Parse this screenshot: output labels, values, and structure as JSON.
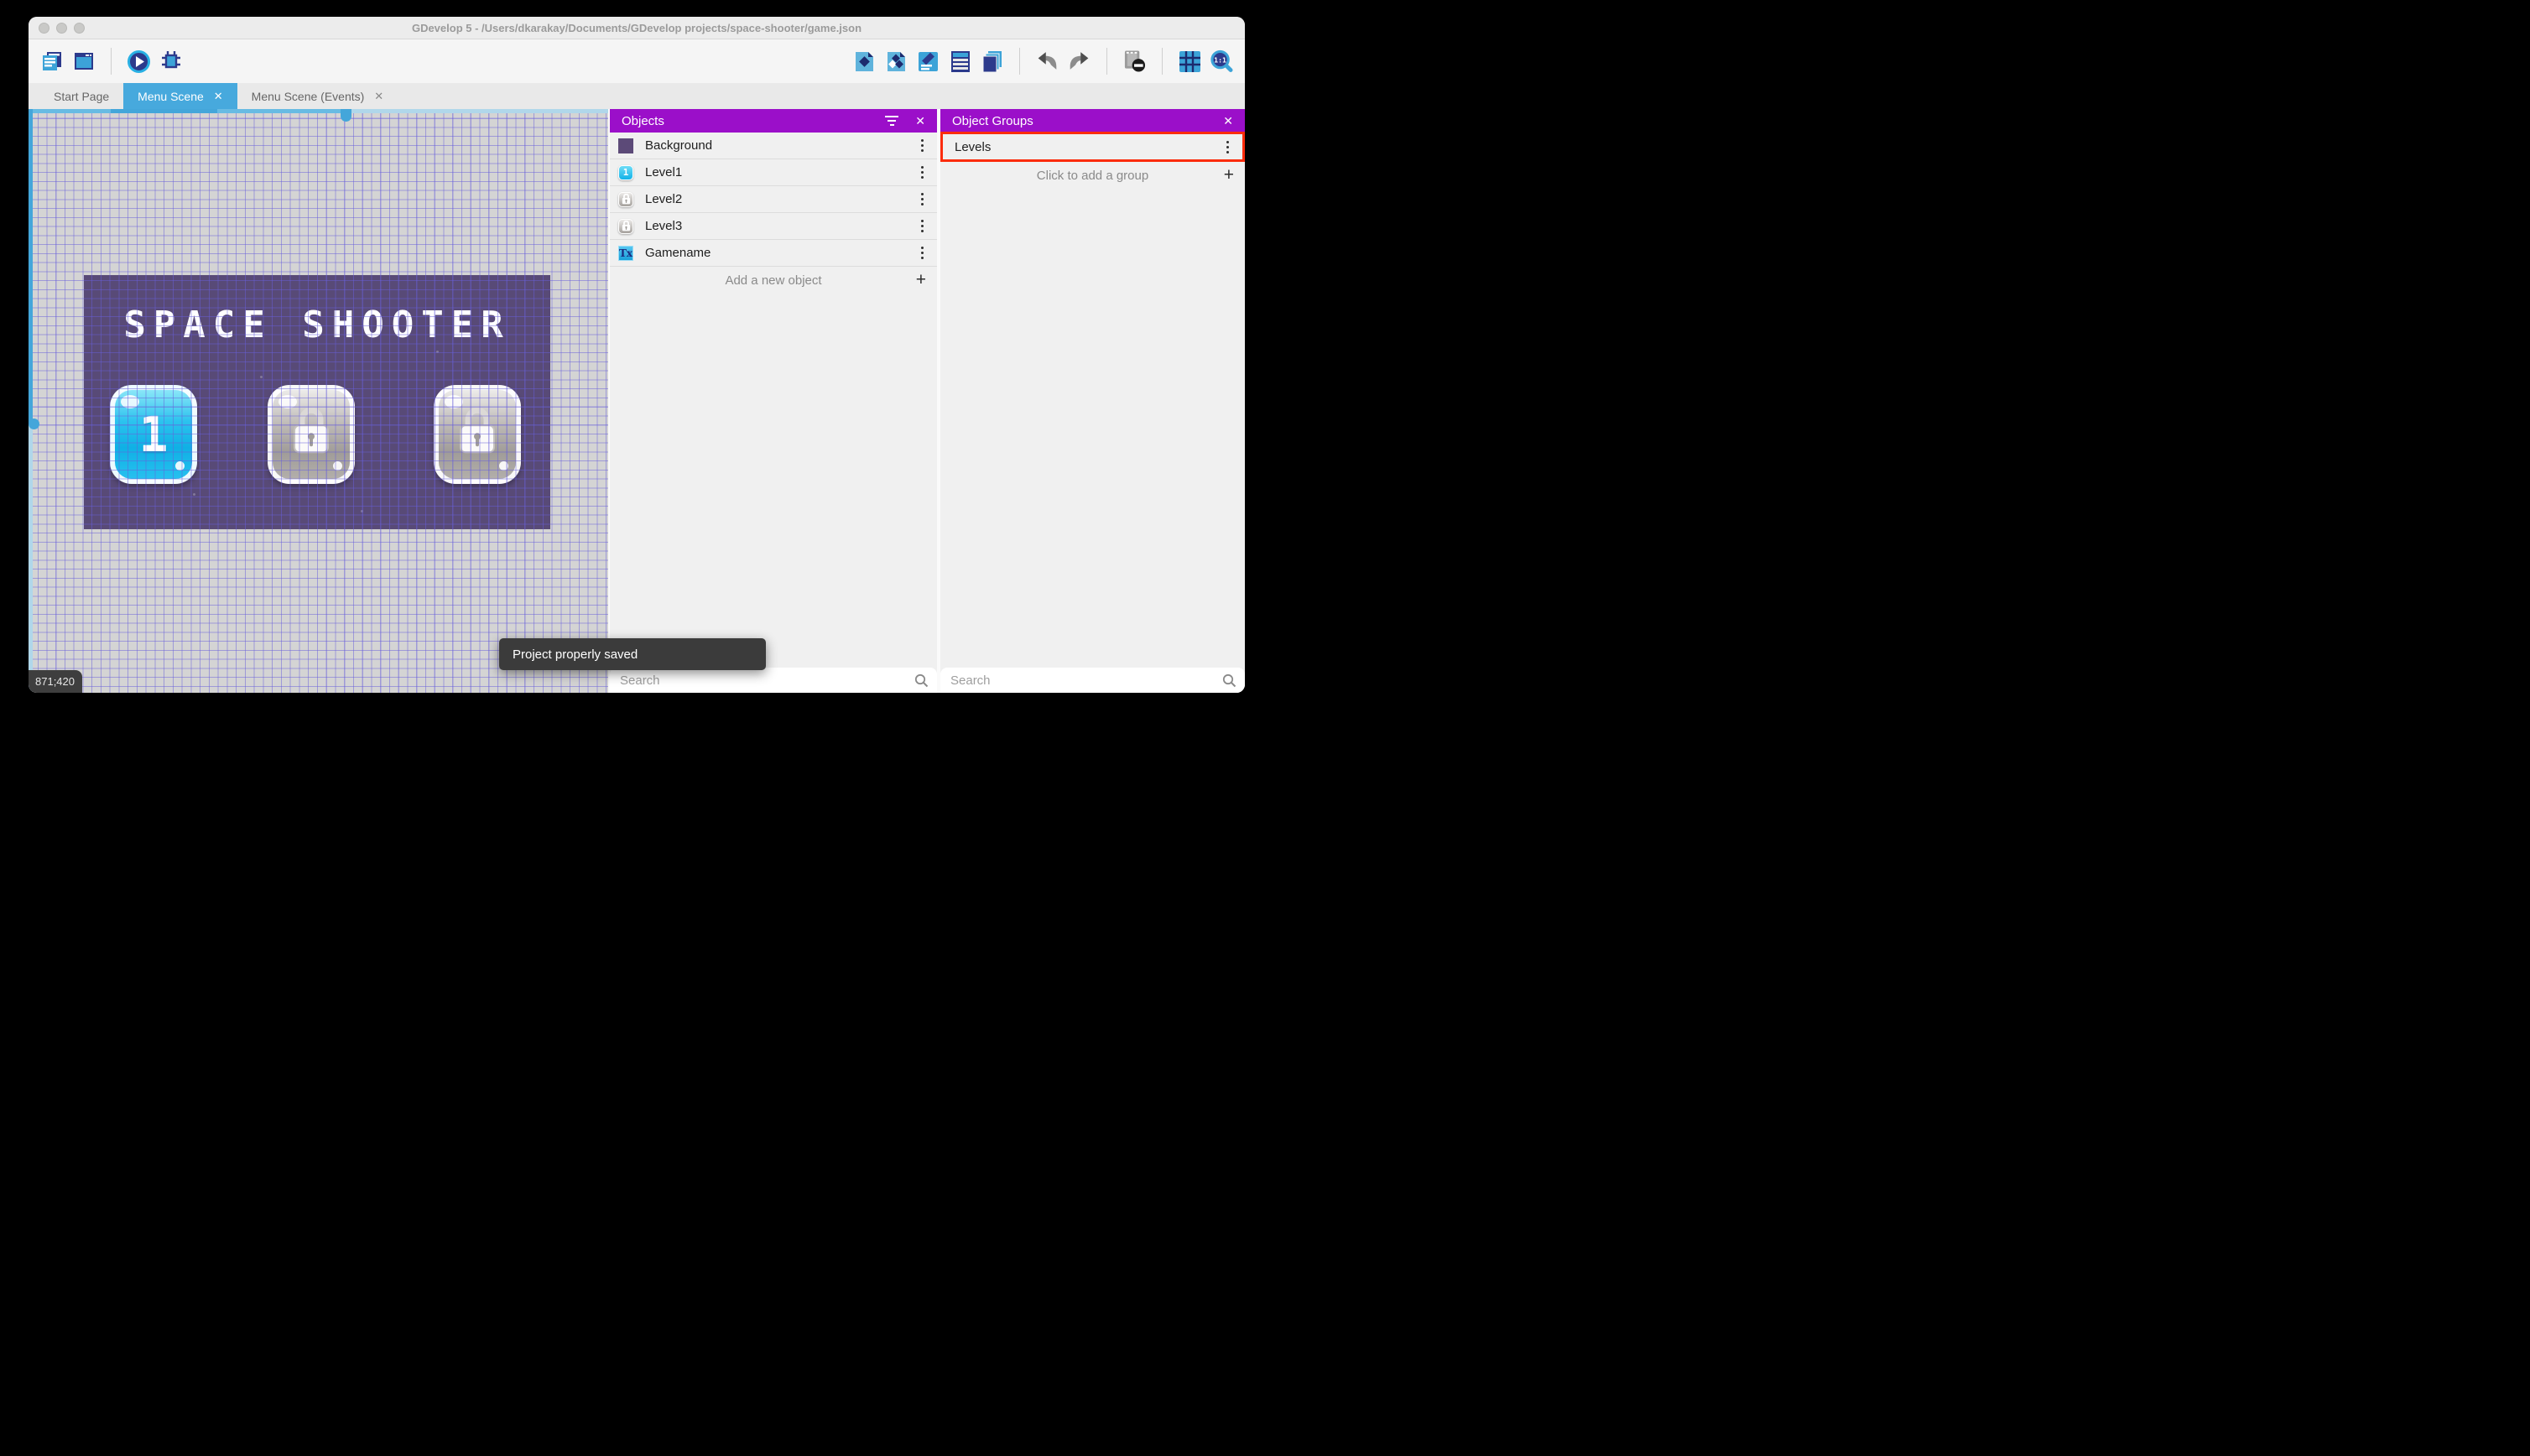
{
  "window_title": "GDevelop 5 - /Users/dkarakay/Documents/GDevelop projects/space-shooter/game.json",
  "glyphs": {
    "close": "✕",
    "plus": "+"
  },
  "toolbar": {
    "left_icons": [
      "project-manager",
      "start-page",
      "play",
      "debug"
    ],
    "right_icons": [
      "edit-objects",
      "edit-object-groups",
      "edit-scene-properties",
      "edit-instances-list",
      "edit-layers",
      "undo",
      "redo",
      "toggle-mask",
      "toggle-grid",
      "zoom-1-1"
    ],
    "zoom_label": "1:1"
  },
  "tabs": [
    {
      "label": "Start Page",
      "active": false,
      "closable": false
    },
    {
      "label": "Menu Scene",
      "active": true,
      "closable": true
    },
    {
      "label": "Menu Scene (Events)",
      "active": false,
      "closable": true
    }
  ],
  "scene": {
    "game_title": "SPACE SHOOTER",
    "level_buttons": [
      {
        "label": "1",
        "locked": false
      },
      {
        "label": "",
        "locked": true
      },
      {
        "label": "",
        "locked": true
      }
    ],
    "cursor_coordinates": "871;420"
  },
  "objects_panel": {
    "title": "Objects",
    "items": [
      {
        "name": "Background",
        "icon": "background-thumbnail",
        "thumb_label": ""
      },
      {
        "name": "Level1",
        "icon": "level-button-thumbnail",
        "thumb_label": "1"
      },
      {
        "name": "Level2",
        "icon": "locked-button-thumbnail",
        "thumb_label": ""
      },
      {
        "name": "Level3",
        "icon": "locked-button-thumbnail",
        "thumb_label": ""
      },
      {
        "name": "Gamename",
        "icon": "text-object-thumbnail",
        "thumb_label": "Tx"
      }
    ],
    "add_label": "Add a new object",
    "search_placeholder": "Search"
  },
  "object_groups_panel": {
    "title": "Object Groups",
    "groups": [
      {
        "name": "Levels",
        "highlighted": true
      }
    ],
    "add_label": "Click to add a group",
    "search_placeholder": "Search"
  },
  "toast_message": "Project properly saved",
  "colors": {
    "panel_header": "#9b0fc9",
    "active_tab": "#47a9dd",
    "highlight_border": "#fb2c0c",
    "scene_background": "#584a77",
    "toolbar_blue": "#3ca3d8",
    "toolbar_navy": "#2c3a8c"
  }
}
